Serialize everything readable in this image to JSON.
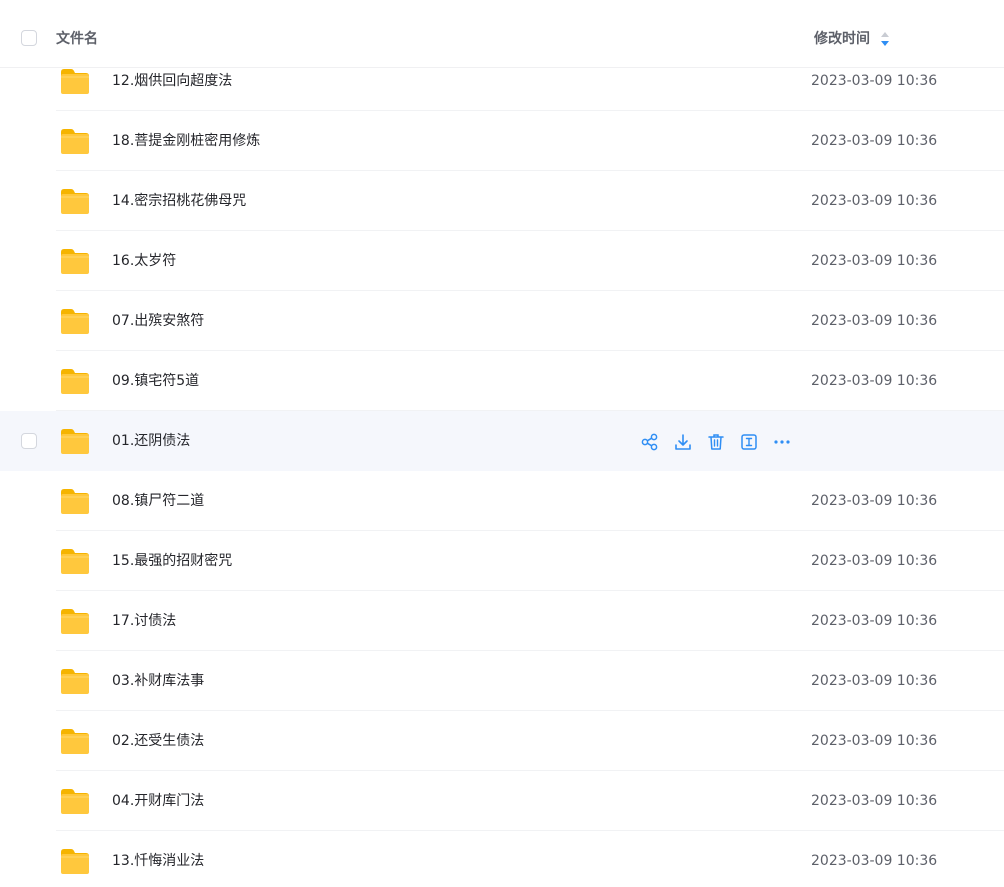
{
  "header": {
    "name_label": "文件名",
    "time_label": "修改时间"
  },
  "colors": {
    "accent": "#2f8ef4",
    "folder": "#ffc83d",
    "folder_back": "#f5b400",
    "hover_bg": "#f5f7fc"
  },
  "rows": [
    {
      "name": "12.烟供回向超度法",
      "time": "2023-03-09 10:36"
    },
    {
      "name": "18.菩提金刚桩密用修炼",
      "time": "2023-03-09 10:36"
    },
    {
      "name": "14.密宗招桃花佛母咒",
      "time": "2023-03-09 10:36"
    },
    {
      "name": "16.太岁符",
      "time": "2023-03-09 10:36"
    },
    {
      "name": "07.出殡安煞符",
      "time": "2023-03-09 10:36"
    },
    {
      "name": "09.镇宅符5道",
      "time": "2023-03-09 10:36"
    },
    {
      "name": "01.还阴债法",
      "time": ""
    },
    {
      "name": "08.镇尸符二道",
      "time": "2023-03-09 10:36"
    },
    {
      "name": "15.最强的招财密咒",
      "time": "2023-03-09 10:36"
    },
    {
      "name": "17.讨债法",
      "time": "2023-03-09 10:36"
    },
    {
      "name": "03.补财库法事",
      "time": "2023-03-09 10:36"
    },
    {
      "name": "02.还受生债法",
      "time": "2023-03-09 10:36"
    },
    {
      "name": "04.开财库门法",
      "time": "2023-03-09 10:36"
    },
    {
      "name": "13.忏悔消业法",
      "time": "2023-03-09 10:36"
    }
  ],
  "hovered_row_actions": [
    "share-icon",
    "download-icon",
    "delete-icon",
    "rename-icon",
    "more-icon"
  ]
}
